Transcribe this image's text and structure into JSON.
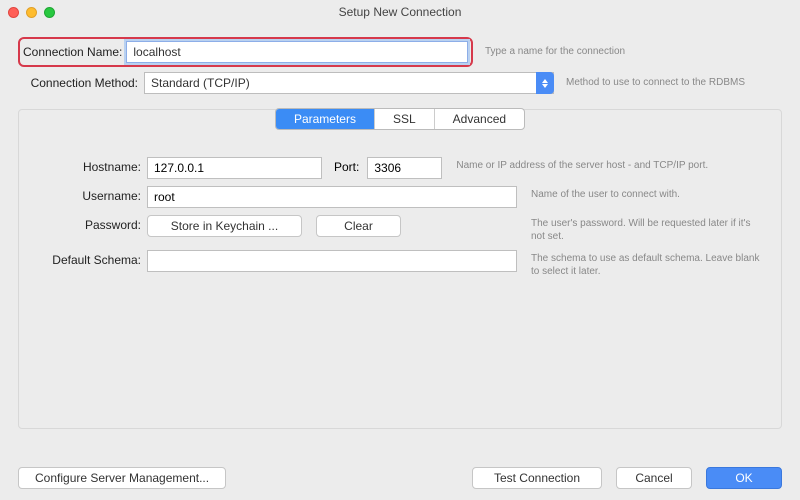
{
  "window": {
    "title": "Setup New Connection"
  },
  "top": {
    "connection_name_label": "Connection Name:",
    "connection_name_value": "localhost",
    "connection_name_hint": "Type a name for the connection",
    "connection_method_label": "Connection Method:",
    "connection_method_value": "Standard (TCP/IP)",
    "connection_method_hint": "Method to use to connect to the RDBMS"
  },
  "tabs": {
    "parameters": "Parameters",
    "ssl": "SSL",
    "advanced": "Advanced"
  },
  "params": {
    "hostname_label": "Hostname:",
    "hostname_value": "127.0.0.1",
    "port_label": "Port:",
    "port_value": "3306",
    "host_hint": "Name or IP address of the server host - and TCP/IP port.",
    "username_label": "Username:",
    "username_value": "root",
    "username_hint": "Name of the user to connect with.",
    "password_label": "Password:",
    "store_btn": "Store in Keychain ...",
    "clear_btn": "Clear",
    "password_hint": "The user's password. Will be requested later if it's not set.",
    "schema_label": "Default Schema:",
    "schema_value": "",
    "schema_hint": "The schema to use as default schema. Leave blank to select it later."
  },
  "footer": {
    "configure": "Configure Server Management...",
    "test": "Test Connection",
    "cancel": "Cancel",
    "ok": "OK"
  }
}
